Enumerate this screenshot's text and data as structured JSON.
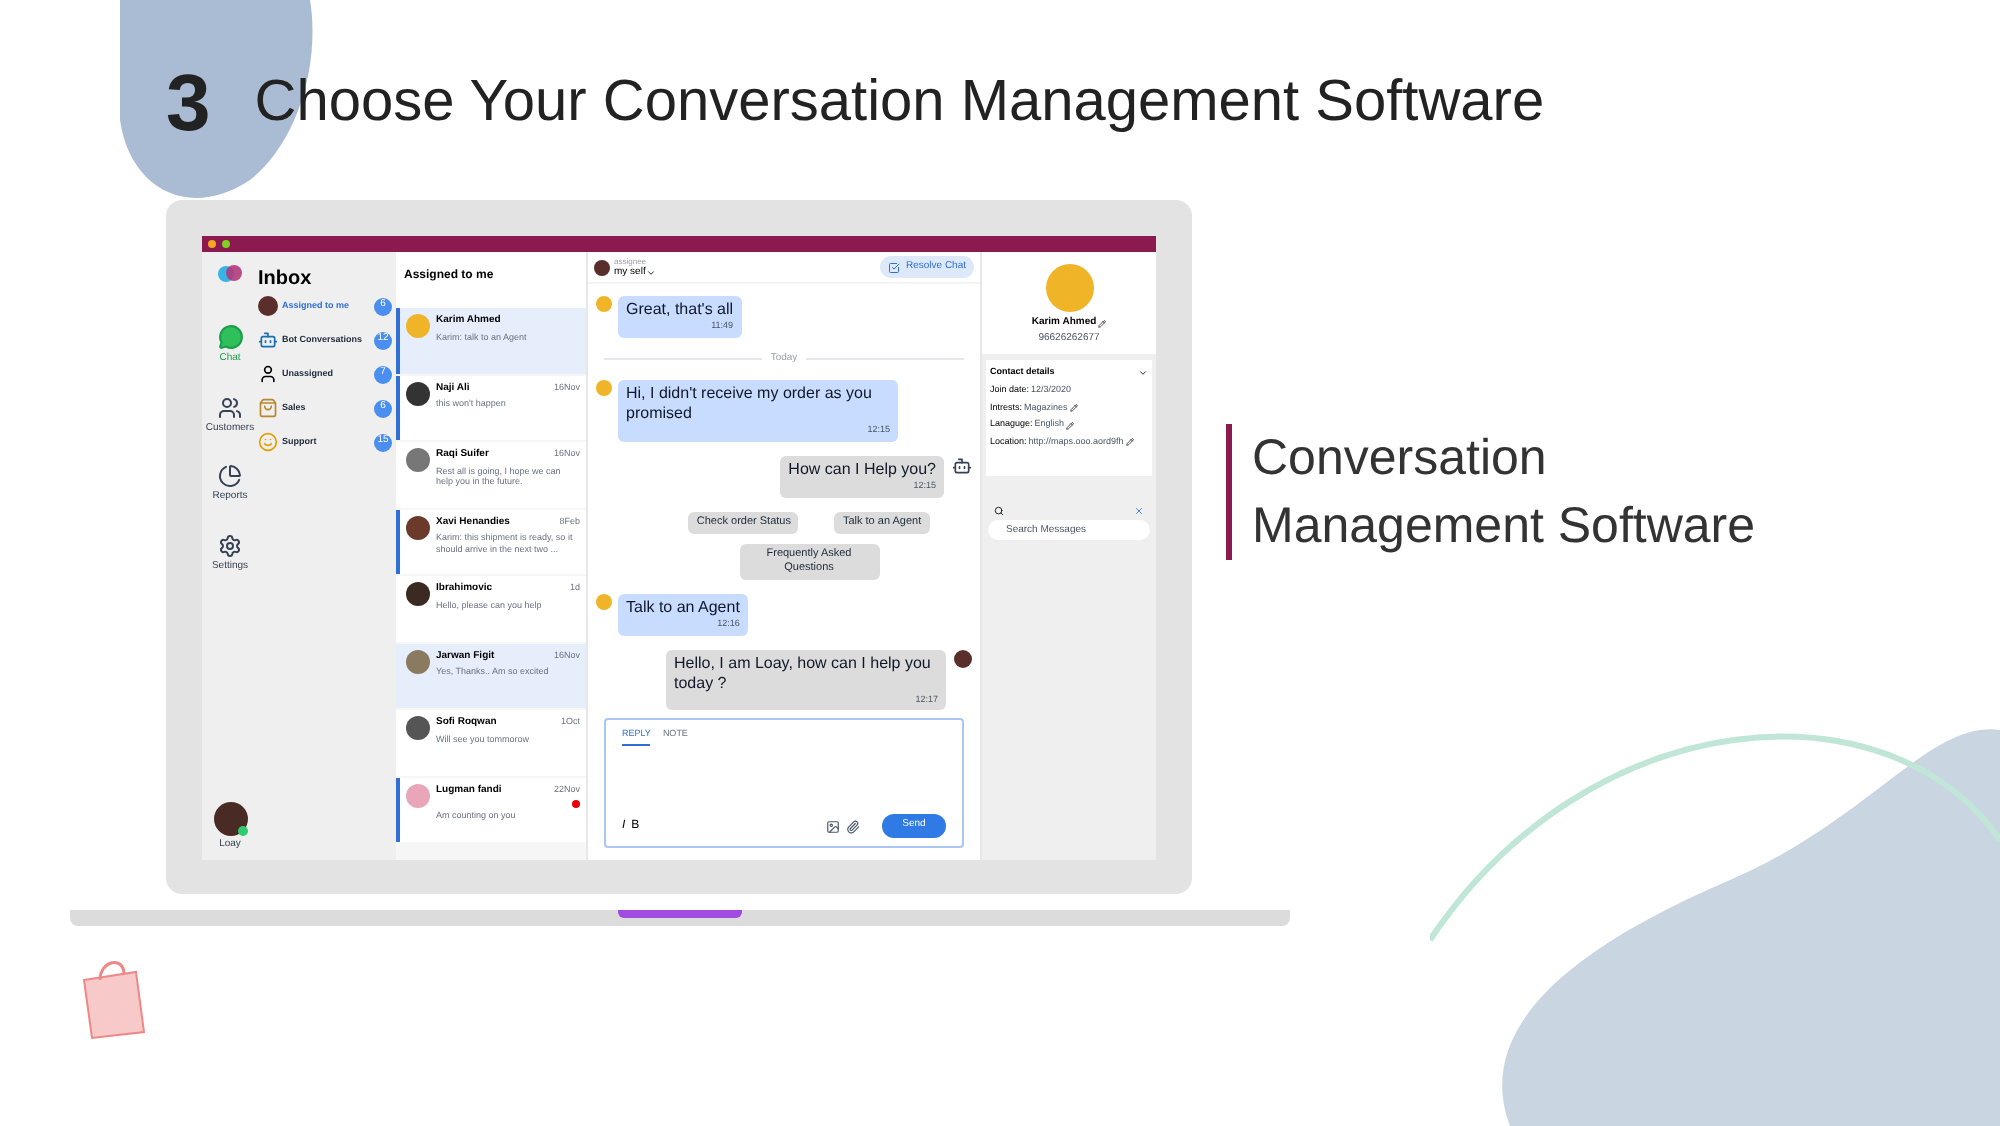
{
  "slide": {
    "step": "3",
    "title": "Choose Your Conversation Management Software",
    "side_heading": "Conversation Management Software"
  },
  "app": {
    "nav": {
      "title": "Inbox",
      "items": [
        {
          "label": "Chat",
          "selected": true
        },
        {
          "label": "Customers",
          "selected": false
        },
        {
          "label": "Reports",
          "selected": false
        },
        {
          "label": "Settings",
          "selected": false
        }
      ],
      "user": "Loay",
      "user_online": true
    },
    "folders": [
      {
        "label": "Assigned to me",
        "count": "6",
        "selected": true
      },
      {
        "label": "Bot Conversations",
        "count": "12",
        "selected": false
      },
      {
        "label": "Unassigned",
        "count": "7",
        "selected": false
      },
      {
        "label": "Sales",
        "count": "6",
        "selected": false
      },
      {
        "label": "Support",
        "count": "15",
        "selected": false
      }
    ],
    "list": {
      "title": "Assigned to me",
      "conversations": [
        {
          "name": "Karim Ahmed",
          "preview": "Karim: talk to an Agent",
          "selected": true,
          "unread": true,
          "alert": false,
          "color": "#f0b429"
        },
        {
          "name": "Naji Ali",
          "preview": "this won't happen",
          "time": "16Nov",
          "selected": false,
          "unread": true,
          "alert": false,
          "color": "#333333"
        },
        {
          "name": "Raqi Suifer",
          "preview": "Rest all is going, I hope we can help you in the future.",
          "time": "16Nov",
          "selected": false,
          "unread": false,
          "alert": false,
          "color": "#777777"
        },
        {
          "name": "Xavi Henandies",
          "preview": "Karim: this shipment is ready, so it should arrive in the next two ...",
          "time": "8Feb",
          "selected": false,
          "unread": true,
          "alert": false,
          "color": "#6b3a2a"
        },
        {
          "name": "Ibrahimovic",
          "preview": "Hello, please can you help",
          "time": "1d",
          "selected": false,
          "unread": false,
          "alert": false,
          "color": "#3a2a22"
        },
        {
          "name": "Jarwan Figit",
          "preview": "Yes, Thanks.. Am so excited",
          "time": "16Nov",
          "selected": true,
          "unread": false,
          "alert": false,
          "color": "#8a7a60"
        },
        {
          "name": "Sofi Roqwan",
          "preview": "Will see you tommorow",
          "time": "1Oct",
          "selected": false,
          "unread": false,
          "alert": false,
          "color": "#555555"
        },
        {
          "name": "Lugman fandi",
          "preview": "Am counting on you",
          "time": "22Nov",
          "selected": false,
          "unread": true,
          "alert": true,
          "color": "#e8a6b8"
        }
      ]
    },
    "chat": {
      "assignee_label": "assignee",
      "assignee": "my self",
      "resolve": "Resolve Chat",
      "messages": [
        {
          "kind": "customer",
          "text": "Great, that's all",
          "time": "11:49"
        },
        {
          "kind": "divider",
          "text": "Today"
        },
        {
          "kind": "customer",
          "text": "Hi, I didn't receive my order as you promised",
          "time": "12:15"
        },
        {
          "kind": "bot",
          "text": "How can I Help you?",
          "time": "12:15"
        },
        {
          "kind": "options",
          "options": [
            "Check order Status",
            "Talk to an Agent",
            "Frequently Asked Questions"
          ]
        },
        {
          "kind": "customer",
          "text": "Talk to an Agent",
          "time": "12:16"
        },
        {
          "kind": "agent",
          "text": "Hello, I am Loay, how can I help you today ?",
          "time": "12:17"
        }
      ],
      "composer": {
        "tabs": [
          {
            "label": "REPLY",
            "selected": true
          },
          {
            "label": "NOTE",
            "selected": false
          }
        ],
        "format": [
          "I",
          "B"
        ],
        "send": "Send"
      }
    },
    "contact": {
      "name": "Karim Ahmed",
      "phone": "96626262677",
      "details_title": "Contact details",
      "fields": [
        {
          "label": "Join date:",
          "value": "12/3/2020",
          "editable": false
        },
        {
          "label": "Intrests:",
          "value": "Magazines",
          "editable": true
        },
        {
          "label": "Lanaguge:",
          "value": "English",
          "editable": true
        },
        {
          "label": "Location:",
          "value": "http://maps.ooo.aord9fh",
          "editable": true
        }
      ],
      "search_placeholder": "Search Messages"
    }
  }
}
